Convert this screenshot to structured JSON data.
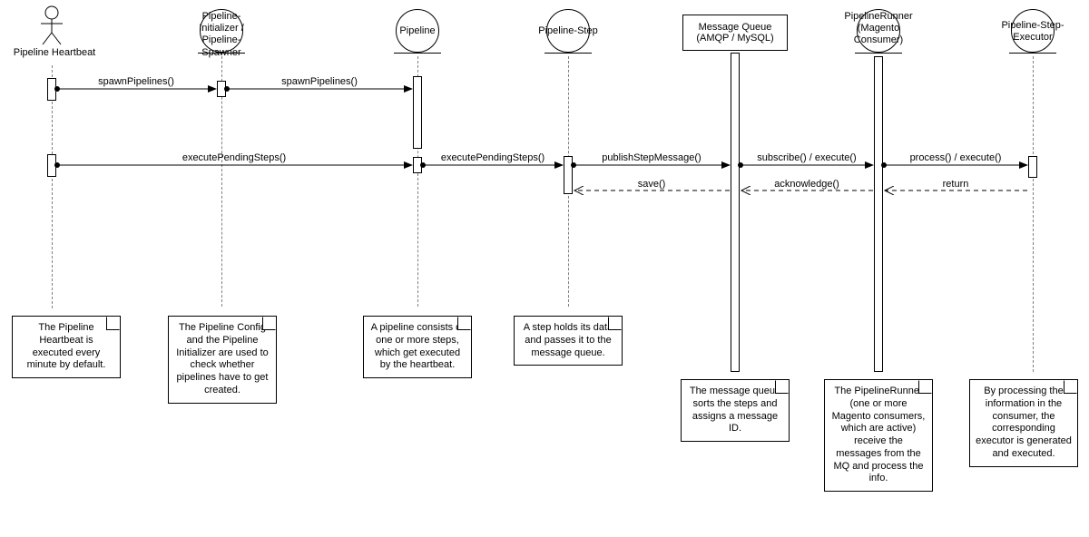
{
  "participants": {
    "p1": {
      "label": "Pipeline Heartbeat"
    },
    "p2": {
      "label": "Pipeline-\nInitializer /\nPipeline-\nSpawner"
    },
    "p3": {
      "label": "Pipeline"
    },
    "p4": {
      "label": "Pipeline-Step"
    },
    "p5": {
      "label": "Message Queue\n(AMQP / MySQL)"
    },
    "p6": {
      "label": "PipelineRunner\n(Magento\nConsumer)"
    },
    "p7": {
      "label": "Pipeline-Step-\nExecutor"
    }
  },
  "messages": {
    "m1": "spawnPipelines()",
    "m2": "spawnPipelines()",
    "m3": "executePendingSteps()",
    "m4": "executePendingSteps()",
    "m5": "publishStepMessage()",
    "m6": "subscribe() / execute()",
    "m7": "process() / execute()",
    "m8": "return",
    "m9": "acknowledge()",
    "m10": "save()"
  },
  "notes": {
    "n1": "The Pipeline Heartbeat is executed every minute by default.",
    "n2": "The Pipeline Config and the Pipeline Initializer are used to check whether pipelines have to get created.",
    "n3": "A pipeline consists of one or more steps, which get executed by the heartbeat.",
    "n4": "A step holds its data and passes it to the message queue.",
    "n5": "The message queue sorts the steps and assigns a message ID.",
    "n6": "The PipelineRunner (one or more Magento consumers, which are active) receive the messages from the MQ and process the info.",
    "n7": "By processing the information in the consumer, the corresponding executor is generated and executed."
  },
  "chart_data": {
    "type": "sequence-diagram",
    "participants": [
      {
        "id": "heartbeat",
        "name": "Pipeline Heartbeat",
        "kind": "actor"
      },
      {
        "id": "initializer",
        "name": "Pipeline-Initializer / Pipeline-Spawner",
        "kind": "control"
      },
      {
        "id": "pipeline",
        "name": "Pipeline",
        "kind": "control"
      },
      {
        "id": "step",
        "name": "Pipeline-Step",
        "kind": "control"
      },
      {
        "id": "mq",
        "name": "Message Queue (AMQP / MySQL)",
        "kind": "queue"
      },
      {
        "id": "runner",
        "name": "PipelineRunner (Magento Consumer)",
        "kind": "control"
      },
      {
        "id": "executor",
        "name": "Pipeline-Step-Executor",
        "kind": "control"
      }
    ],
    "messages": [
      {
        "from": "heartbeat",
        "to": "initializer",
        "label": "spawnPipelines()",
        "type": "sync"
      },
      {
        "from": "initializer",
        "to": "pipeline",
        "label": "spawnPipelines()",
        "type": "sync"
      },
      {
        "from": "heartbeat",
        "to": "pipeline",
        "label": "executePendingSteps()",
        "type": "sync"
      },
      {
        "from": "pipeline",
        "to": "step",
        "label": "executePendingSteps()",
        "type": "sync"
      },
      {
        "from": "step",
        "to": "mq",
        "label": "publishStepMessage()",
        "type": "sync"
      },
      {
        "from": "mq",
        "to": "runner",
        "label": "subscribe() / execute()",
        "type": "sync"
      },
      {
        "from": "runner",
        "to": "executor",
        "label": "process() / execute()",
        "type": "sync"
      },
      {
        "from": "executor",
        "to": "runner",
        "label": "return",
        "type": "return"
      },
      {
        "from": "runner",
        "to": "mq",
        "label": "acknowledge()",
        "type": "return"
      },
      {
        "from": "mq",
        "to": "step",
        "label": "save()",
        "type": "return"
      }
    ],
    "notes": [
      {
        "attached_to": "heartbeat",
        "text": "The Pipeline Heartbeat is executed every minute by default."
      },
      {
        "attached_to": "initializer",
        "text": "The Pipeline Config and the Pipeline Initializer are used to check whether pipelines have to get created."
      },
      {
        "attached_to": "pipeline",
        "text": "A pipeline consists of one or more steps, which get executed by the heartbeat."
      },
      {
        "attached_to": "step",
        "text": "A step holds its data and passes it to the message queue."
      },
      {
        "attached_to": "mq",
        "text": "The message queue sorts the steps and assigns a message ID."
      },
      {
        "attached_to": "runner",
        "text": "The PipelineRunner (one or more Magento consumers, which are active) receive the messages from the MQ and process the info."
      },
      {
        "attached_to": "executor",
        "text": "By processing the information in the consumer, the corresponding executor is generated and executed."
      }
    ]
  }
}
